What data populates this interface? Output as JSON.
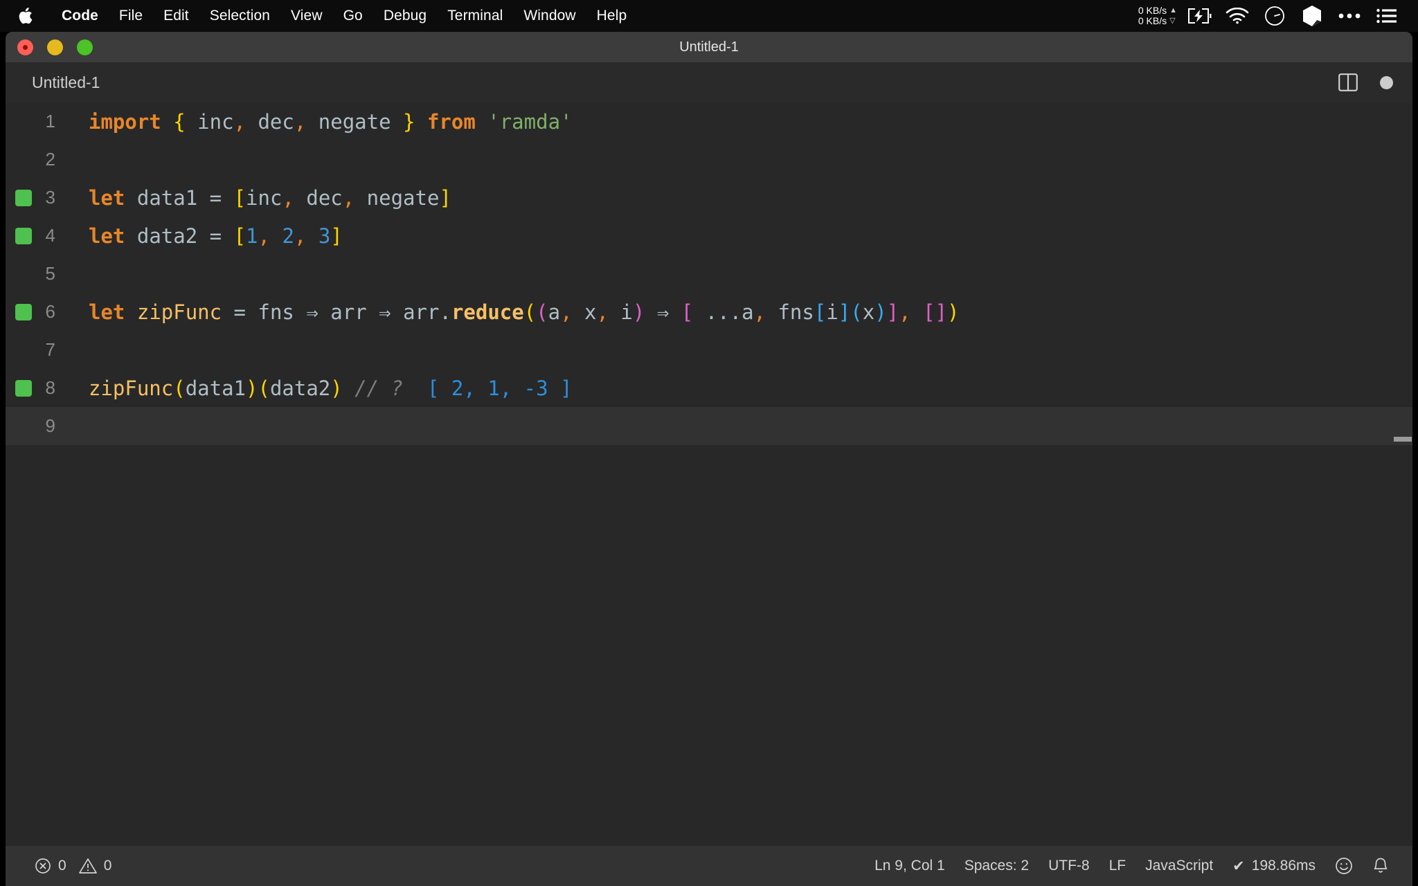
{
  "menubar": {
    "apple_icon": "apple-logo-icon",
    "items": [
      {
        "label": "Code",
        "bold": true
      },
      {
        "label": "File",
        "bold": false
      },
      {
        "label": "Edit",
        "bold": false
      },
      {
        "label": "Selection",
        "bold": false
      },
      {
        "label": "View",
        "bold": false
      },
      {
        "label": "Go",
        "bold": false
      },
      {
        "label": "Debug",
        "bold": false
      },
      {
        "label": "Terminal",
        "bold": false
      },
      {
        "label": "Window",
        "bold": false
      },
      {
        "label": "Help",
        "bold": false
      }
    ],
    "network": {
      "upload": "0 KB/s",
      "download": "0 KB/s",
      "up_arrow": "▲",
      "down_arrow": "▽"
    },
    "tray_icons": [
      "battery-charging-icon",
      "wifi-icon",
      "timer-icon",
      "hexagon-icon",
      "ellipsis-icon",
      "list-menu-icon"
    ]
  },
  "window": {
    "title": "Untitled-1",
    "traffic_lights": [
      "close-button",
      "minimize-button",
      "maximize-button"
    ]
  },
  "tabbar": {
    "tab_label": "Untitled-1",
    "split_editor_icon": "split-editor-icon",
    "unsaved_dot": "unsaved-changes-dot"
  },
  "editor": {
    "language": "JavaScript",
    "active_line": 9,
    "lines": [
      {
        "num": "1",
        "deco": false,
        "active": false
      },
      {
        "num": "2",
        "deco": false,
        "active": false
      },
      {
        "num": "3",
        "deco": true,
        "active": false
      },
      {
        "num": "4",
        "deco": true,
        "active": false
      },
      {
        "num": "5",
        "deco": false,
        "active": false
      },
      {
        "num": "6",
        "deco": true,
        "active": false
      },
      {
        "num": "7",
        "deco": false,
        "active": false
      },
      {
        "num": "8",
        "deco": true,
        "active": false
      },
      {
        "num": "9",
        "deco": false,
        "active": true
      }
    ],
    "source": [
      "import { inc, dec, negate } from 'ramda'",
      "",
      "let data1 = [inc, dec, negate]",
      "let data2 = [1, 2, 3]",
      "",
      "let zipFunc = fns => arr => arr.reduce((a, x, i) => [ ...a, fns[i](x)], [])",
      "",
      "zipFunc(data1)(data2) // ?  [ 2, 1, -3 ]",
      ""
    ],
    "inline_value": "[ 2, 1, -3 ]",
    "comment_text": "// ?",
    "colors": {
      "background": "#282828",
      "keyword": "#e8862a",
      "identifier": "#b0bec5",
      "string": "#7fb069",
      "number": "#3f95d6",
      "function": "#f5c065",
      "comment": "#7d7d7d",
      "bracket_yellow": "#ffd500",
      "bracket_magenta": "#e060c8",
      "bracket_blue": "#3aa9f0",
      "gutter_marker_green": "#4ec14e",
      "inline_value_blue": "#2c8ddd"
    }
  },
  "statusbar": {
    "errors_icon": "error-circle-icon",
    "errors_count": "0",
    "warnings_icon": "warning-triangle-icon",
    "warnings_count": "0",
    "cursor_position": "Ln 9, Col 1",
    "indentation": "Spaces: 2",
    "encoding": "UTF-8",
    "eol": "LF",
    "language_mode": "JavaScript",
    "runtime_check": "✔",
    "runtime_time": "198.86ms",
    "feedback_icon": "smiley-icon",
    "notifications_icon": "bell-icon"
  }
}
